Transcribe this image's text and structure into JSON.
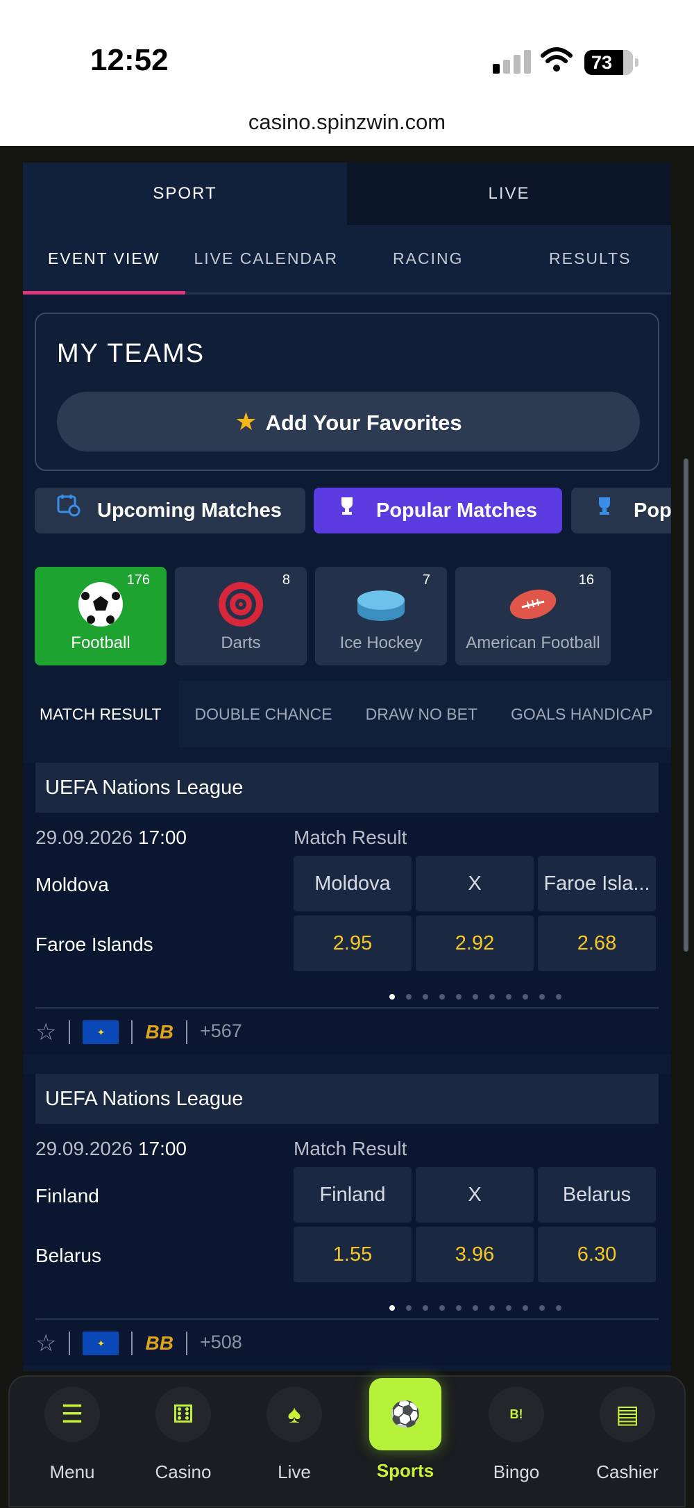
{
  "status": {
    "time": "12:52",
    "battery": "73"
  },
  "browser": {
    "url": "casino.spinzwin.com"
  },
  "top_tabs": [
    "SPORT",
    "LIVE"
  ],
  "sub_tabs": [
    "EVENT VIEW",
    "LIVE CALENDAR",
    "RACING",
    "RESULTS"
  ],
  "my_teams": {
    "title": "MY TEAMS",
    "add_label": "Add Your Favorites"
  },
  "chips": [
    "Upcoming Matches",
    "Popular Matches",
    "Pop"
  ],
  "sports": [
    {
      "label": "Football",
      "count": "176"
    },
    {
      "label": "Darts",
      "count": "8"
    },
    {
      "label": "Ice Hockey",
      "count": "7"
    },
    {
      "label": "American Football",
      "count": "16"
    }
  ],
  "markets": [
    "MATCH RESULT",
    "DOUBLE CHANCE",
    "DRAW NO BET",
    "GOALS HANDICAP"
  ],
  "matches": [
    {
      "league": "UEFA Nations League",
      "date": "29.09.2026",
      "time": "17:00",
      "market": "Match Result",
      "home": "Moldova",
      "away": "Faroe Islands",
      "headers": [
        "Moldova",
        "X",
        "Faroe Isla..."
      ],
      "odds": [
        "2.95",
        "2.92",
        "2.68"
      ],
      "more": "+567"
    },
    {
      "league": "UEFA Nations League",
      "date": "29.09.2026",
      "time": "17:00",
      "market": "Match Result",
      "home": "Finland",
      "away": "Belarus",
      "headers": [
        "Finland",
        "X",
        "Belarus"
      ],
      "odds": [
        "1.55",
        "3.96",
        "6.30"
      ],
      "more": "+508"
    }
  ],
  "footer_badge": "BB",
  "bottom_nav": [
    "Menu",
    "Casino",
    "Live",
    "Sports",
    "Bingo",
    "Cashier"
  ],
  "colors": {
    "accent_pink": "#e0367a",
    "active_green": "#1ea331",
    "popular_purple": "#5a3ce0",
    "odds_yellow": "#f5c823",
    "nav_lime": "#b7f23a"
  }
}
